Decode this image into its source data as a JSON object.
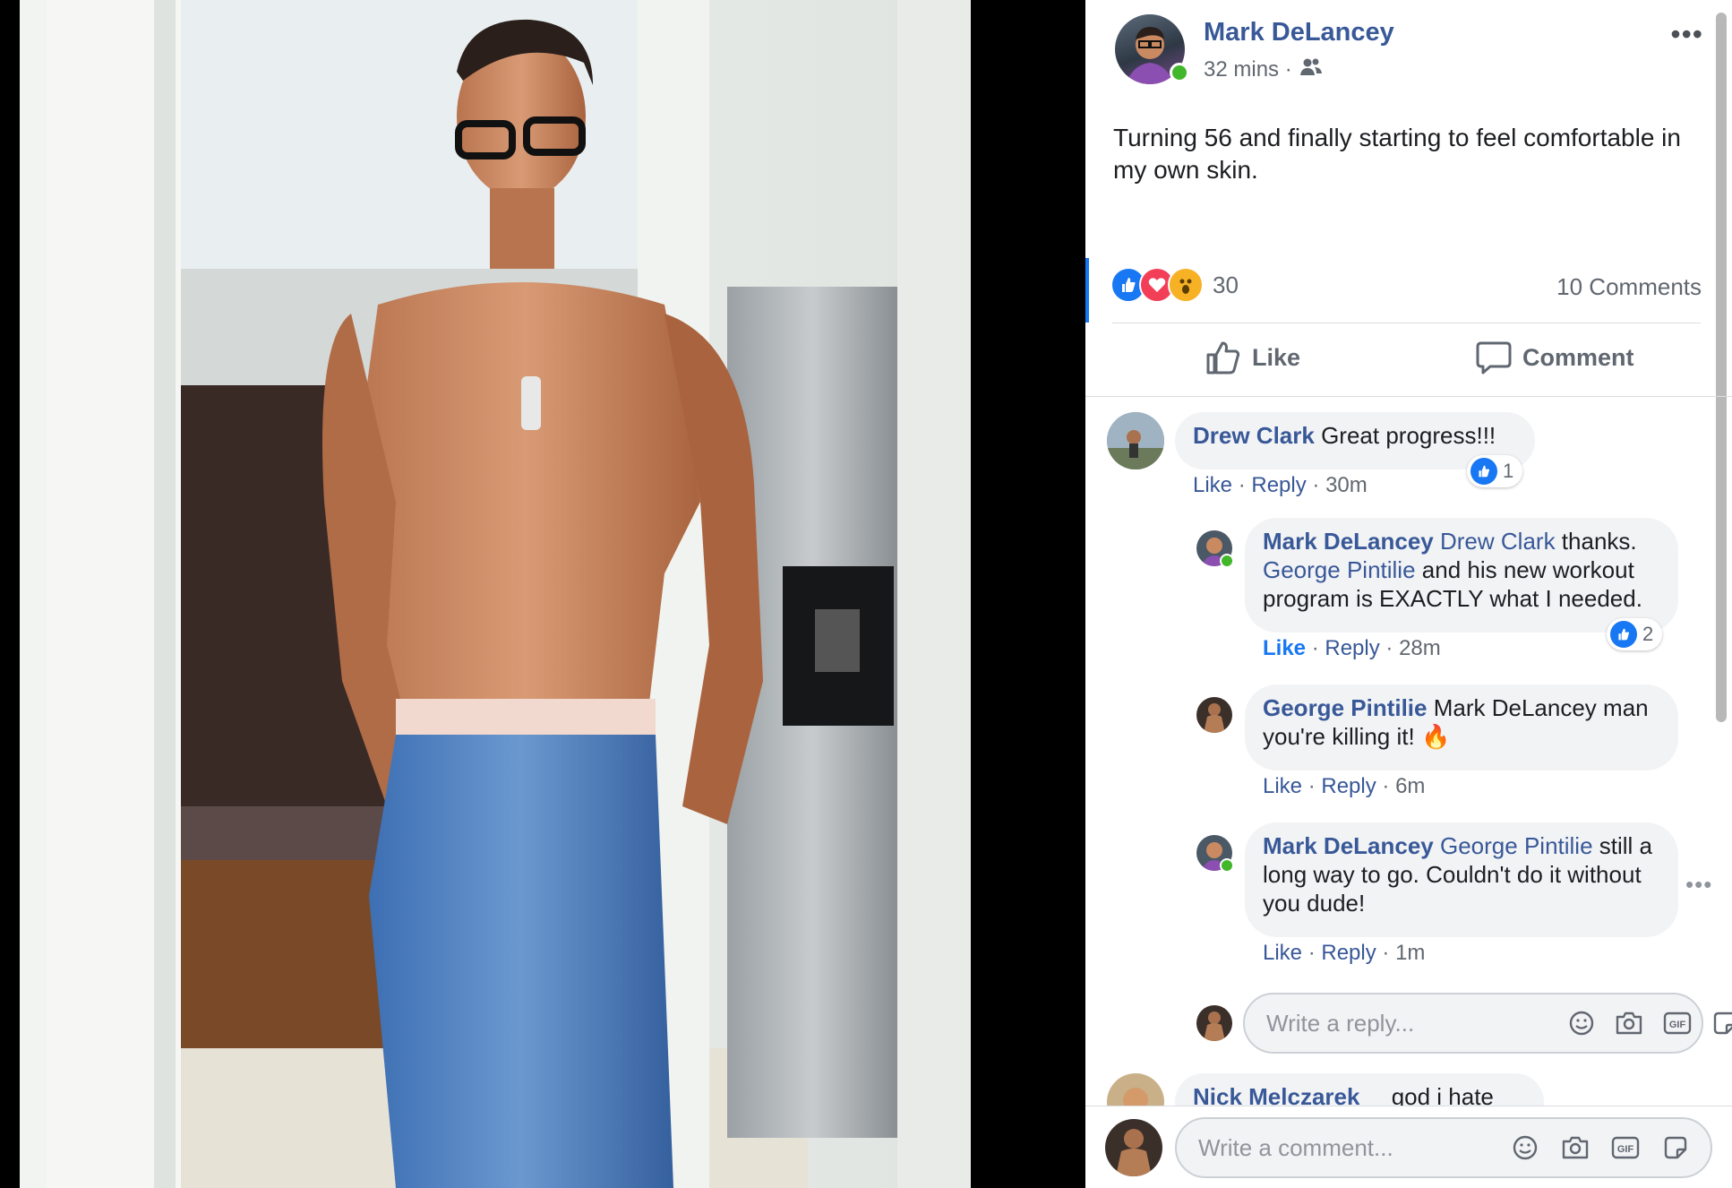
{
  "post": {
    "author": "Mark DeLancey",
    "time": "32 mins",
    "time_separator": "·",
    "audience_icon": "friends-icon",
    "text": "Turning 56 and finally starting to feel comfortable in my own skin.",
    "reaction_count": "30",
    "comments_count": "10 Comments",
    "more_label": "•••"
  },
  "actions": {
    "like": "Like",
    "comment": "Comment"
  },
  "comments": [
    {
      "author": "Drew Clark",
      "text": "Great progress!!!",
      "like": "Like",
      "reply": "Reply",
      "sep": "·",
      "time": "30m",
      "likes": "1"
    },
    {
      "author": "Mark DeLancey",
      "mention": "Drew Clark",
      "text1": " thanks.",
      "mention2": "George Pintilie",
      "text2": " and his new workout program is EXACTLY what I needed.",
      "like": "Like",
      "reply": "Reply",
      "sep": "·",
      "time": "28m",
      "likes": "2"
    },
    {
      "author": "George Pintilie",
      "mention": "Mark DeLancey",
      "text": " man you're killing it!",
      "emoji": "🔥",
      "like": "Like",
      "reply": "Reply",
      "sep": "·",
      "time": "6m"
    },
    {
      "author": "Mark DeLancey",
      "mention": "George Pintilie",
      "text": " still a long way to go. Couldn't do it without you dude!",
      "like": "Like",
      "reply": "Reply",
      "sep": "·",
      "time": "1m"
    },
    {
      "author": "Nick Melczarek",
      "text": "god i hate you"
    }
  ],
  "reply_box": {
    "placeholder": "Write a reply..."
  },
  "comment_box": {
    "placeholder": "Write a comment..."
  },
  "icons": [
    "emoji-icon",
    "camera-icon",
    "gif-icon",
    "sticker-icon"
  ],
  "colors": {
    "link": "#385898",
    "accent": "#1877f2",
    "online": "#42b72a"
  }
}
